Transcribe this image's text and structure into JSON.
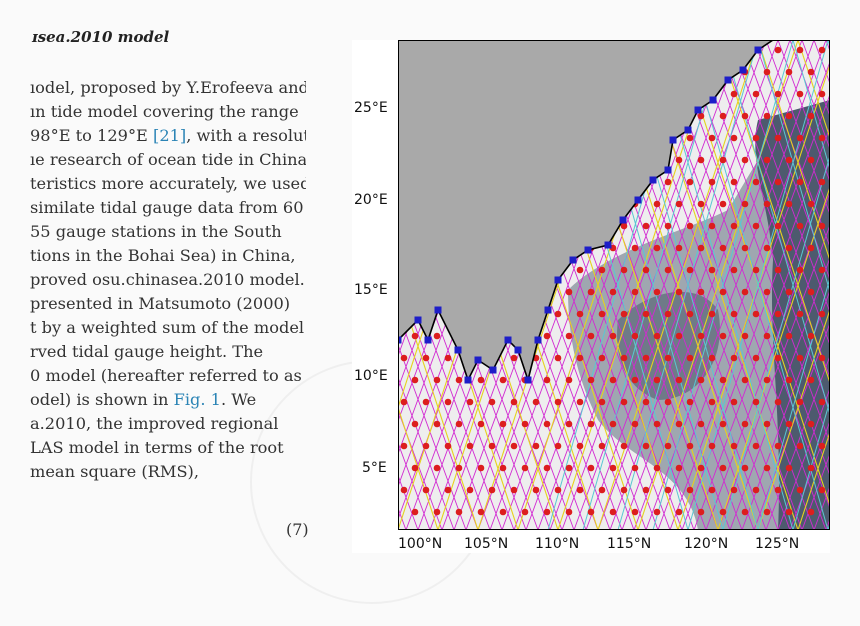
{
  "heading": "ɪsea.2010 model",
  "paragraph_lines": [
    {
      "text": "ıodel, proposed by Y.Erofeeva and"
    },
    {
      "text": "ın tide model covering the range"
    },
    {
      "pre": "98°E to 129°E ",
      "ref": "[21]",
      "post": ", with a resolution"
    },
    {
      "text": "ıe research of ocean tide in China."
    },
    {
      "text": "teristics more accurately, we used"
    },
    {
      "text": "similate tidal gauge data from 60"
    },
    {
      "text": "55 gauge stations in the South"
    },
    {
      "text": "tions in the Bohai Sea) in China,"
    },
    {
      "text": "proved osu.chinasea.2010 model."
    },
    {
      "text": " presented in Matsumoto (2000)"
    },
    {
      "text": "t by a weighted sum of the model"
    },
    {
      "text": "rved tidal gauge height. The"
    },
    {
      "text": "0 model (hereafter referred to as"
    },
    {
      "pre": "odel) is shown in ",
      "ref": "Fig. 1",
      "post": ". We"
    },
    {
      "text": "a.2010, the improved regional"
    },
    {
      "text": "LAS model in terms of the root"
    },
    {
      "text": "mean square (RMS),"
    }
  ],
  "equation_number": "(7)",
  "map": {
    "y_axis_labels": [
      "25°E",
      "20°E",
      "15°E",
      "10°E",
      "5°E"
    ],
    "x_axis_labels": [
      "100°N",
      "105°N",
      "110°N",
      "115°N",
      "120°N",
      "125°N"
    ],
    "colors": {
      "land": "#a9a9a9",
      "coastline": "#000000",
      "shelf_sea": "#f0f0f0",
      "deep_sea": "#4d5a6e",
      "track_magenta": "#d22ad2",
      "track_yellow": "#e6d21e",
      "track_cyan": "#5ac8d2",
      "tide_gauge_square": "#1e1ec8",
      "grid_point_circle": "#dc1e1e"
    },
    "markers": [
      "blue-square",
      "red-circle"
    ]
  }
}
